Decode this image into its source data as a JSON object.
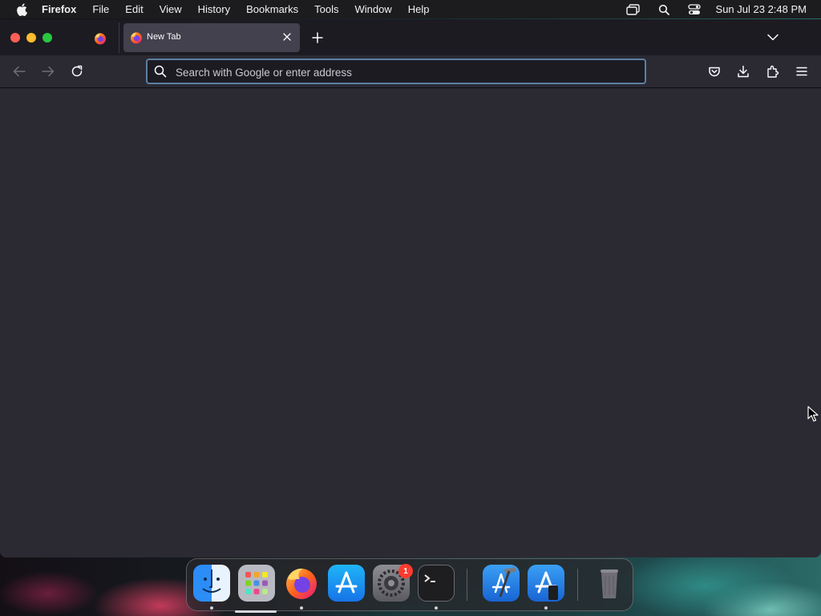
{
  "menubar": {
    "app_name": "Firefox",
    "items": [
      "File",
      "Edit",
      "View",
      "History",
      "Bookmarks",
      "Tools",
      "Window",
      "Help"
    ],
    "clock": "Sun Jul 23  2:48 PM",
    "status_icons": [
      "screen-mirroring-icon",
      "spotlight-search-icon",
      "control-center-icon"
    ]
  },
  "browser": {
    "tabs": [
      {
        "title": "New Tab",
        "active": true
      }
    ],
    "url_placeholder": "Search with Google or enter address",
    "toolbar_icons": [
      "pocket-icon",
      "downloads-icon",
      "extensions-icon",
      "menu-icon"
    ]
  },
  "dock": {
    "apps": [
      "Finder",
      "Launchpad",
      "Firefox",
      "App Store",
      "System Settings",
      "Terminal",
      "Xcode",
      "Simulator",
      "Trash"
    ],
    "system_settings_badge": "1"
  },
  "colors": {
    "menubar_bg": "#1c1c1e",
    "tabstrip_bg": "#1c1b22",
    "toolbar_bg": "#2b2a33",
    "active_tab_bg": "#42414d",
    "urlbar_border": "#5b7fa3"
  }
}
